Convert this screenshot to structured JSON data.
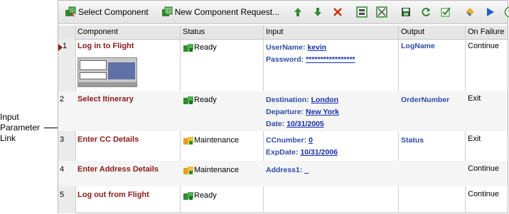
{
  "callout": {
    "line1": "Input",
    "line2": "Parameter",
    "line3": "Link"
  },
  "toolbar": {
    "select_component": "Select Component",
    "new_component_request": "New Component Request..."
  },
  "columns": {
    "component": "Component",
    "status": "Status",
    "input": "Input",
    "output": "Output",
    "on_failure": "On Failure"
  },
  "rows": [
    {
      "num": "1",
      "component": "Log in to Flight",
      "status": "Ready",
      "status_icon": "component-ready-icon",
      "inputs": [
        {
          "label": "UserName:",
          "value": "kevin"
        },
        {
          "label": "Password:",
          "value": "*****************"
        }
      ],
      "output": "LogName",
      "on_failure": "Continue"
    },
    {
      "num": "2",
      "component": "Select Itinerary",
      "status": "Ready",
      "status_icon": "component-ready-icon",
      "inputs": [
        {
          "label": "Destination:",
          "value": "London"
        },
        {
          "label": "Departure:",
          "value": "New York"
        },
        {
          "label": "Date:",
          "value": "10/31/2005"
        }
      ],
      "output": "OrderNumber",
      "on_failure": "Exit"
    },
    {
      "num": "3",
      "component": "Enter CC Details",
      "status": "Maintenance",
      "status_icon": "component-maintenance-icon",
      "inputs": [
        {
          "label": "CCnumber:",
          "value": "0"
        },
        {
          "label": "ExpDate:",
          "value": "10/31/2006"
        }
      ],
      "output": "Status",
      "on_failure": "Exit"
    },
    {
      "num": "4",
      "component": "Enter Address Details",
      "status": "Maintenance",
      "status_icon": "component-maintenance-icon",
      "inputs": [
        {
          "label": "Address1:",
          "value": "_"
        }
      ],
      "output": "",
      "on_failure": "Continue"
    },
    {
      "num": "5",
      "component": "Log out from Flight",
      "status": "Ready",
      "status_icon": "component-ready-icon",
      "inputs": [],
      "output": "",
      "on_failure": "Continue"
    }
  ],
  "colors": {
    "component_text": "#8b1a1a",
    "link_text": "#2d4aa8",
    "arrow_up": "#2e8b2e",
    "delete": "#cc3300",
    "run": "#2060d0"
  }
}
